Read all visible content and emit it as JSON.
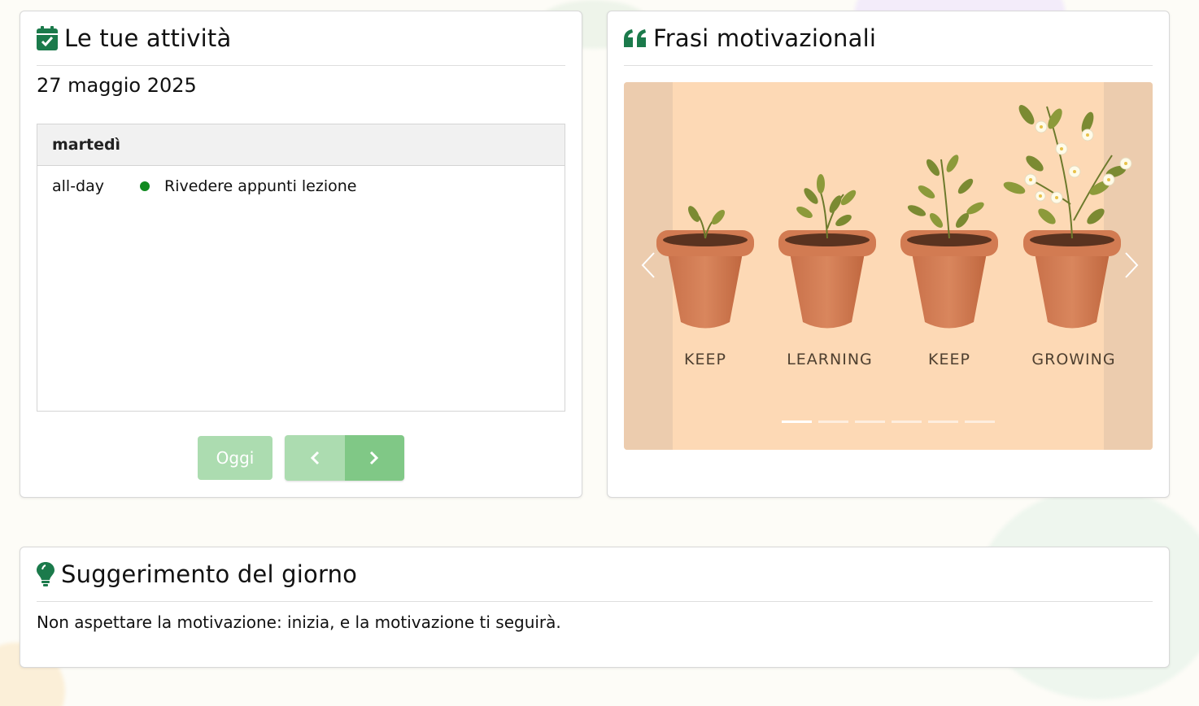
{
  "activities": {
    "title": "Le tue attività",
    "date": "27 maggio 2025",
    "day_label": "martedì",
    "events": [
      {
        "time": "all-day",
        "title": "Rivedere appunti lezione",
        "color": "#108a1f"
      }
    ],
    "today_button": "Oggi",
    "prev_icon": "chevron-left-icon",
    "next_icon": "chevron-right-icon"
  },
  "quotes": {
    "title": "Frasi motivazionali",
    "icon": "quote-icon",
    "slide": {
      "labels": [
        "KEEP",
        "LEARNING",
        "KEEP",
        "GROWING"
      ],
      "background": "#fdd9b5"
    },
    "indicator_count": 6,
    "active_indicator": 0
  },
  "suggestion": {
    "title": "Suggerimento del giorno",
    "icon": "lightbulb-icon",
    "text": "Non aspettare la motivazione: inizia, e la motivazione ti seguirà."
  },
  "colors": {
    "accent": "#1b7a4b",
    "button_light": "#acdcb0",
    "button_dark": "#80c886"
  }
}
